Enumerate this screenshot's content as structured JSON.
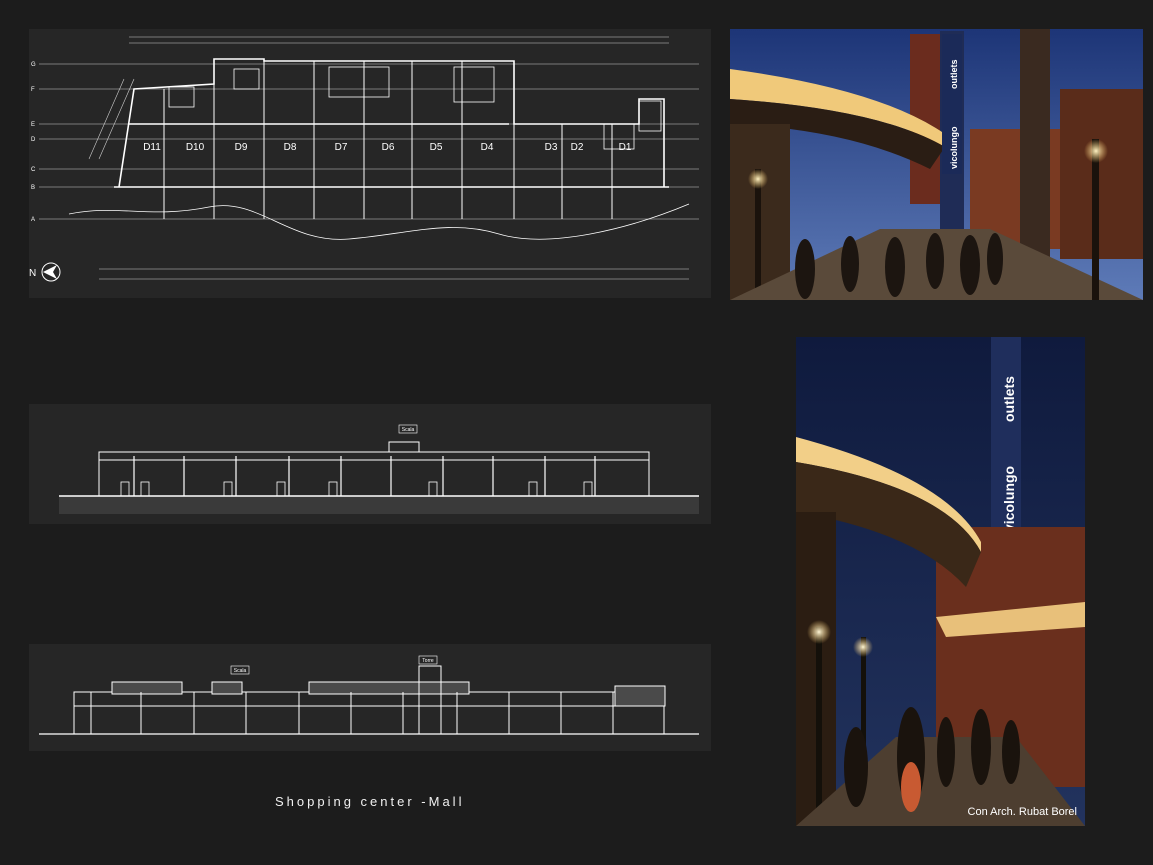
{
  "plan": {
    "units": [
      "D11",
      "D10",
      "D9",
      "D8",
      "D7",
      "D6",
      "D5",
      "D4",
      "D3",
      "D2",
      "D1"
    ],
    "grid_rows": [
      "G",
      "F",
      "E",
      "D",
      "C",
      "B",
      "A"
    ],
    "north_label": "N"
  },
  "section": {
    "tag": "Scala"
  },
  "elevation": {
    "tags": [
      "Scala",
      "Torre"
    ]
  },
  "photo_sign": {
    "brand": "vicolungo",
    "word": "outlets"
  },
  "caption": "Shopping center -Mall",
  "credit": "Con Arch. Rubat Borel",
  "colors": {
    "background": "#1c1c1c",
    "panel": "#262626",
    "sky": "#15254a",
    "warm_light": "#f5c76a"
  }
}
